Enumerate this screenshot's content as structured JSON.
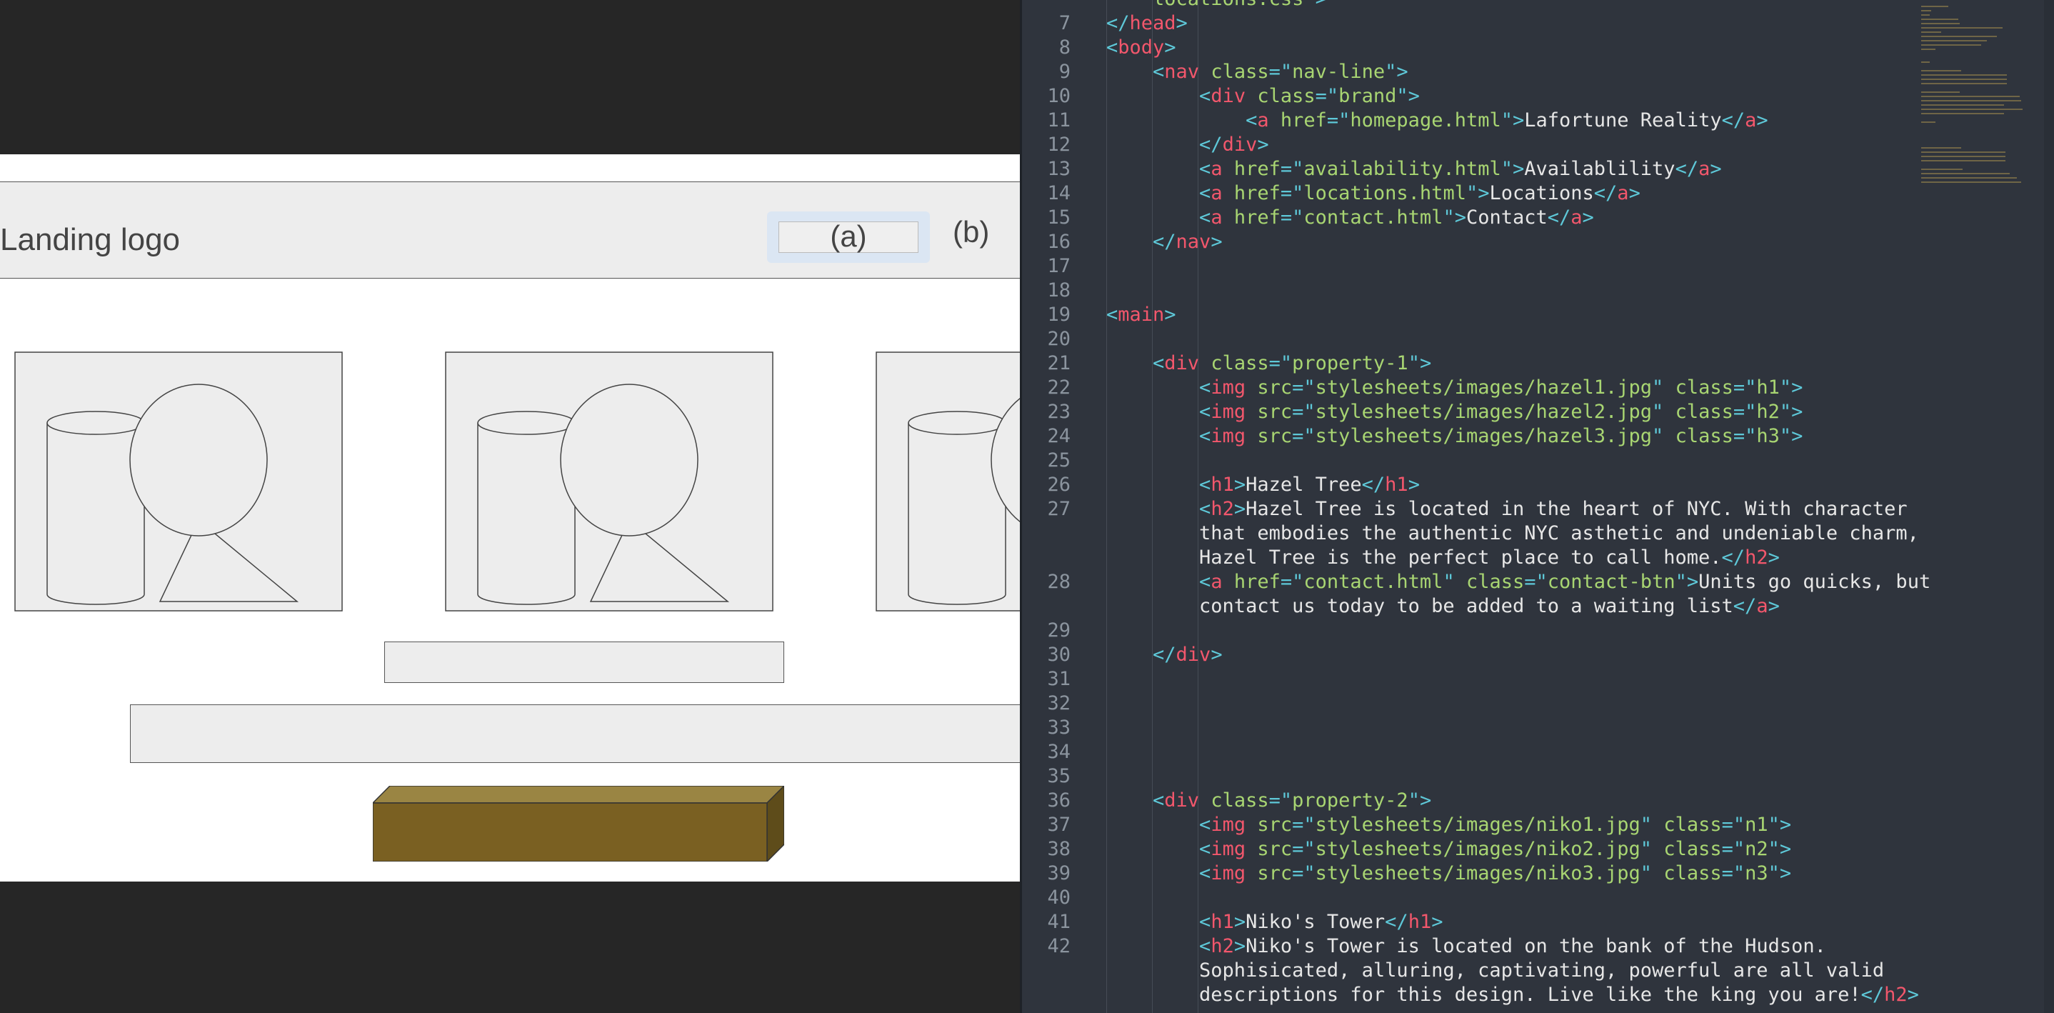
{
  "preview": {
    "logo_text": "Landing logo",
    "nav_button_a": "(a)",
    "nav_button_b": "(b)"
  },
  "editor": {
    "lines": [
      {
        "n": "",
        "segs": [
          [
            "x",
            "    "
          ],
          [
            "a",
            "locations.css"
          ],
          [
            "p",
            "\">"
          ]
        ]
      },
      {
        "n": "7",
        "segs": [
          [
            "p",
            "</"
          ],
          [
            "t",
            "head"
          ],
          [
            "p",
            ">"
          ]
        ]
      },
      {
        "n": "8",
        "segs": [
          [
            "p",
            "<"
          ],
          [
            "t",
            "body"
          ],
          [
            "p",
            ">"
          ]
        ]
      },
      {
        "n": "9",
        "segs": [
          [
            "x",
            "    "
          ],
          [
            "p",
            "<"
          ],
          [
            "t",
            "nav "
          ],
          [
            "a",
            "class"
          ],
          [
            "p",
            "=\""
          ],
          [
            "a",
            "nav-line"
          ],
          [
            "p",
            "\">"
          ]
        ]
      },
      {
        "n": "10",
        "segs": [
          [
            "x",
            "        "
          ],
          [
            "p",
            "<"
          ],
          [
            "t",
            "div "
          ],
          [
            "a",
            "class"
          ],
          [
            "p",
            "=\""
          ],
          [
            "a",
            "brand"
          ],
          [
            "p",
            "\">"
          ]
        ]
      },
      {
        "n": "11",
        "segs": [
          [
            "x",
            "            "
          ],
          [
            "p",
            "<"
          ],
          [
            "t",
            "a "
          ],
          [
            "a",
            "href"
          ],
          [
            "p",
            "=\""
          ],
          [
            "a",
            "homepage.html"
          ],
          [
            "p",
            "\">"
          ],
          [
            "x",
            "Lafortune Reality"
          ],
          [
            "p",
            "</"
          ],
          [
            "t",
            "a"
          ],
          [
            "p",
            ">"
          ]
        ]
      },
      {
        "n": "12",
        "segs": [
          [
            "x",
            "        "
          ],
          [
            "p",
            "</"
          ],
          [
            "t",
            "div"
          ],
          [
            "p",
            ">"
          ]
        ]
      },
      {
        "n": "13",
        "segs": [
          [
            "x",
            "        "
          ],
          [
            "p",
            "<"
          ],
          [
            "t",
            "a "
          ],
          [
            "a",
            "href"
          ],
          [
            "p",
            "=\""
          ],
          [
            "a",
            "availability.html"
          ],
          [
            "p",
            "\">"
          ],
          [
            "x",
            "Availablility"
          ],
          [
            "p",
            "</"
          ],
          [
            "t",
            "a"
          ],
          [
            "p",
            ">"
          ]
        ]
      },
      {
        "n": "14",
        "segs": [
          [
            "x",
            "        "
          ],
          [
            "p",
            "<"
          ],
          [
            "t",
            "a "
          ],
          [
            "a",
            "href"
          ],
          [
            "p",
            "=\""
          ],
          [
            "a",
            "locations.html"
          ],
          [
            "p",
            "\">"
          ],
          [
            "x",
            "Locations"
          ],
          [
            "p",
            "</"
          ],
          [
            "t",
            "a"
          ],
          [
            "p",
            ">"
          ]
        ]
      },
      {
        "n": "15",
        "segs": [
          [
            "x",
            "        "
          ],
          [
            "p",
            "<"
          ],
          [
            "t",
            "a "
          ],
          [
            "a",
            "href"
          ],
          [
            "p",
            "=\""
          ],
          [
            "a",
            "contact.html"
          ],
          [
            "p",
            "\">"
          ],
          [
            "x",
            "Contact"
          ],
          [
            "p",
            "</"
          ],
          [
            "t",
            "a"
          ],
          [
            "p",
            ">"
          ]
        ]
      },
      {
        "n": "16",
        "segs": [
          [
            "x",
            "    "
          ],
          [
            "p",
            "</"
          ],
          [
            "t",
            "nav"
          ],
          [
            "p",
            ">"
          ]
        ]
      },
      {
        "n": "17",
        "segs": []
      },
      {
        "n": "18",
        "segs": []
      },
      {
        "n": "19",
        "segs": [
          [
            "p",
            "<"
          ],
          [
            "t",
            "main"
          ],
          [
            "p",
            ">"
          ]
        ]
      },
      {
        "n": "20",
        "segs": []
      },
      {
        "n": "21",
        "segs": [
          [
            "x",
            "    "
          ],
          [
            "p",
            "<"
          ],
          [
            "t",
            "div "
          ],
          [
            "a",
            "class"
          ],
          [
            "p",
            "=\""
          ],
          [
            "a",
            "property-1"
          ],
          [
            "p",
            "\">"
          ]
        ]
      },
      {
        "n": "22",
        "segs": [
          [
            "x",
            "        "
          ],
          [
            "p",
            "<"
          ],
          [
            "t",
            "img "
          ],
          [
            "a",
            "src"
          ],
          [
            "p",
            "=\""
          ],
          [
            "a",
            "stylesheets/images/hazel1.jpg"
          ],
          [
            "p",
            "\" "
          ],
          [
            "a",
            "class"
          ],
          [
            "p",
            "=\""
          ],
          [
            "a",
            "h1"
          ],
          [
            "p",
            "\">"
          ]
        ]
      },
      {
        "n": "23",
        "segs": [
          [
            "x",
            "        "
          ],
          [
            "p",
            "<"
          ],
          [
            "t",
            "img "
          ],
          [
            "a",
            "src"
          ],
          [
            "p",
            "=\""
          ],
          [
            "a",
            "stylesheets/images/hazel2.jpg"
          ],
          [
            "p",
            "\" "
          ],
          [
            "a",
            "class"
          ],
          [
            "p",
            "=\""
          ],
          [
            "a",
            "h2"
          ],
          [
            "p",
            "\">"
          ]
        ]
      },
      {
        "n": "24",
        "segs": [
          [
            "x",
            "        "
          ],
          [
            "p",
            "<"
          ],
          [
            "t",
            "img "
          ],
          [
            "a",
            "src"
          ],
          [
            "p",
            "=\""
          ],
          [
            "a",
            "stylesheets/images/hazel3.jpg"
          ],
          [
            "p",
            "\" "
          ],
          [
            "a",
            "class"
          ],
          [
            "p",
            "=\""
          ],
          [
            "a",
            "h3"
          ],
          [
            "p",
            "\">"
          ]
        ]
      },
      {
        "n": "25",
        "segs": []
      },
      {
        "n": "26",
        "segs": [
          [
            "x",
            "        "
          ],
          [
            "p",
            "<"
          ],
          [
            "t",
            "h1"
          ],
          [
            "p",
            ">"
          ],
          [
            "x",
            "Hazel Tree"
          ],
          [
            "p",
            "</"
          ],
          [
            "t",
            "h1"
          ],
          [
            "p",
            ">"
          ]
        ]
      },
      {
        "n": "27",
        "segs": [
          [
            "x",
            "        "
          ],
          [
            "p",
            "<"
          ],
          [
            "t",
            "h2"
          ],
          [
            "p",
            ">"
          ],
          [
            "x",
            "Hazel Tree is located in the heart of NYC. With character"
          ]
        ]
      },
      {
        "n": "",
        "segs": [
          [
            "x",
            "        that embodies the authentic NYC asthetic and undeniable charm,"
          ]
        ]
      },
      {
        "n": "",
        "segs": [
          [
            "x",
            "        Hazel Tree is the perfect place to call home."
          ],
          [
            "p",
            "</"
          ],
          [
            "t",
            "h2"
          ],
          [
            "p",
            ">"
          ]
        ]
      },
      {
        "n": "28",
        "segs": [
          [
            "x",
            "        "
          ],
          [
            "p",
            "<"
          ],
          [
            "t",
            "a "
          ],
          [
            "a",
            "href"
          ],
          [
            "p",
            "=\""
          ],
          [
            "a",
            "contact.html"
          ],
          [
            "p",
            "\" "
          ],
          [
            "a",
            "class"
          ],
          [
            "p",
            "=\""
          ],
          [
            "a",
            "contact-btn"
          ],
          [
            "p",
            "\">"
          ],
          [
            "x",
            "Units go quicks, but"
          ]
        ]
      },
      {
        "n": "",
        "segs": [
          [
            "x",
            "        contact us today to be added to a waiting list"
          ],
          [
            "p",
            "</"
          ],
          [
            "t",
            "a"
          ],
          [
            "p",
            ">"
          ]
        ]
      },
      {
        "n": "29",
        "segs": []
      },
      {
        "n": "30",
        "segs": [
          [
            "x",
            "    "
          ],
          [
            "p",
            "</"
          ],
          [
            "t",
            "div"
          ],
          [
            "p",
            ">"
          ]
        ]
      },
      {
        "n": "31",
        "segs": []
      },
      {
        "n": "32",
        "segs": []
      },
      {
        "n": "33",
        "segs": []
      },
      {
        "n": "34",
        "segs": []
      },
      {
        "n": "35",
        "segs": []
      },
      {
        "n": "36",
        "segs": [
          [
            "x",
            "    "
          ],
          [
            "p",
            "<"
          ],
          [
            "t",
            "div "
          ],
          [
            "a",
            "class"
          ],
          [
            "p",
            "=\""
          ],
          [
            "a",
            "property-2"
          ],
          [
            "p",
            "\">"
          ]
        ]
      },
      {
        "n": "37",
        "segs": [
          [
            "x",
            "        "
          ],
          [
            "p",
            "<"
          ],
          [
            "t",
            "img "
          ],
          [
            "a",
            "src"
          ],
          [
            "p",
            "=\""
          ],
          [
            "a",
            "stylesheets/images/niko1.jpg"
          ],
          [
            "p",
            "\" "
          ],
          [
            "a",
            "class"
          ],
          [
            "p",
            "=\""
          ],
          [
            "a",
            "n1"
          ],
          [
            "p",
            "\">"
          ]
        ]
      },
      {
        "n": "38",
        "segs": [
          [
            "x",
            "        "
          ],
          [
            "p",
            "<"
          ],
          [
            "t",
            "img "
          ],
          [
            "a",
            "src"
          ],
          [
            "p",
            "=\""
          ],
          [
            "a",
            "stylesheets/images/niko2.jpg"
          ],
          [
            "p",
            "\" "
          ],
          [
            "a",
            "class"
          ],
          [
            "p",
            "=\""
          ],
          [
            "a",
            "n2"
          ],
          [
            "p",
            "\">"
          ]
        ]
      },
      {
        "n": "39",
        "segs": [
          [
            "x",
            "        "
          ],
          [
            "p",
            "<"
          ],
          [
            "t",
            "img "
          ],
          [
            "a",
            "src"
          ],
          [
            "p",
            "=\""
          ],
          [
            "a",
            "stylesheets/images/niko3.jpg"
          ],
          [
            "p",
            "\" "
          ],
          [
            "a",
            "class"
          ],
          [
            "p",
            "=\""
          ],
          [
            "a",
            "n3"
          ],
          [
            "p",
            "\">"
          ]
        ]
      },
      {
        "n": "40",
        "segs": []
      },
      {
        "n": "41",
        "segs": [
          [
            "x",
            "        "
          ],
          [
            "p",
            "<"
          ],
          [
            "t",
            "h1"
          ],
          [
            "p",
            ">"
          ],
          [
            "x",
            "Niko's Tower"
          ],
          [
            "p",
            "</"
          ],
          [
            "t",
            "h1"
          ],
          [
            "p",
            ">"
          ]
        ]
      },
      {
        "n": "42",
        "segs": [
          [
            "x",
            "        "
          ],
          [
            "p",
            "<"
          ],
          [
            "t",
            "h2"
          ],
          [
            "p",
            ">"
          ],
          [
            "x",
            "Niko's Tower is located on the bank of the Hudson."
          ]
        ]
      },
      {
        "n": "",
        "segs": [
          [
            "x",
            "        Sophisicated, alluring, captivating, powerful are all valid"
          ]
        ]
      },
      {
        "n": "",
        "segs": [
          [
            "x",
            "        descriptions for this design. Live like the king you are!"
          ],
          [
            "p",
            "</"
          ],
          [
            "t",
            "h2"
          ],
          [
            "p",
            ">"
          ]
        ]
      }
    ]
  }
}
